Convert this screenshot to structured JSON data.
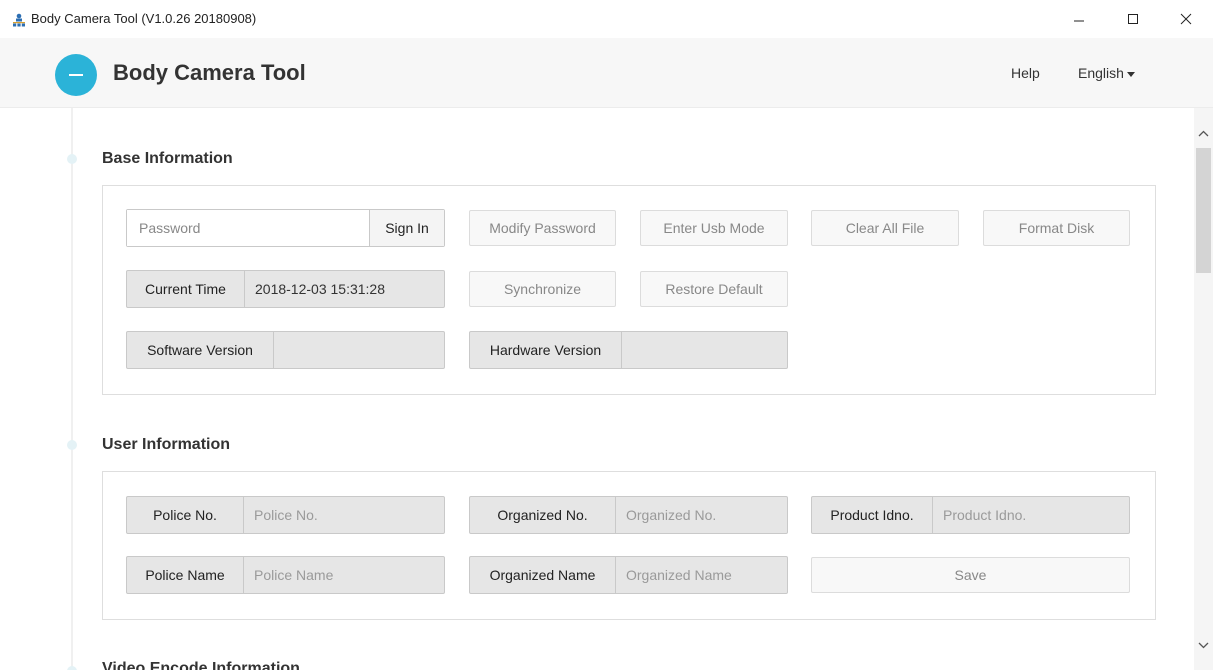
{
  "window": {
    "title": "Body Camera Tool  (V1.0.26 20180908)",
    "icon": "people-network-icon"
  },
  "header": {
    "brand": "Body Camera Tool",
    "help": "Help",
    "language": "English",
    "accent_color": "#2bb3d8"
  },
  "base_info": {
    "title": "Base Information",
    "password_placeholder": "Password",
    "sign_in": "Sign In",
    "modify_password": "Modify Password",
    "enter_usb_mode": "Enter Usb Mode",
    "clear_all_file": "Clear All File",
    "format_disk": "Format Disk",
    "current_time_label": "Current Time",
    "current_time_value": "2018-12-03 15:31:28",
    "synchronize": "Synchronize",
    "restore_default": "Restore Default",
    "software_version_label": "Software Version",
    "software_version_value": "",
    "hardware_version_label": "Hardware Version",
    "hardware_version_value": ""
  },
  "user_info": {
    "title": "User Information",
    "police_no_label": "Police No.",
    "police_no_placeholder": "Police No.",
    "organized_no_label": "Organized No.",
    "organized_no_placeholder": "Organized No.",
    "product_idno_label": "Product Idno.",
    "product_idno_placeholder": "Product Idno.",
    "police_name_label": "Police Name",
    "police_name_placeholder": "Police Name",
    "organized_name_label": "Organized Name",
    "organized_name_placeholder": "Organized Name",
    "save": "Save"
  },
  "video_info": {
    "title": "Video Encode Information"
  }
}
